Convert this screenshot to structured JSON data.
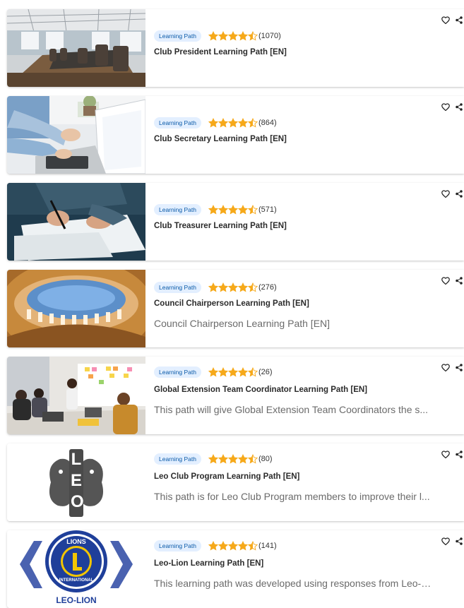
{
  "colors": {
    "star": "#f6a91a",
    "badge_bg": "#e3efff",
    "badge_text": "#0a5aa8"
  },
  "cards": [
    {
      "image": "conference-room-image",
      "badge": "Learning Path",
      "rating": 4.5,
      "count": "(1070)",
      "title": "Club President Learning Path [EN]",
      "description": ""
    },
    {
      "image": "laptop-desk-image",
      "badge": "Learning Path",
      "rating": 4.5,
      "count": "(864)",
      "title": "Club Secretary Learning Path [EN]",
      "description": ""
    },
    {
      "image": "signing-document-image",
      "badge": "Learning Path",
      "rating": 4.5,
      "count": "(571)",
      "title": "Club Treasurer Learning Path [EN]",
      "description": ""
    },
    {
      "image": "dome-ceiling-image",
      "badge": "Learning Path",
      "rating": 4.5,
      "count": "(276)",
      "title": "Council Chairperson Learning Path [EN]",
      "description": "Council Chairperson Learning Path [EN]"
    },
    {
      "image": "team-meeting-image",
      "badge": "Learning Path",
      "rating": 4.5,
      "count": "(26)",
      "title": "Global Extension Team Coordinator Learning Path [EN]",
      "description": "This path will give Global Extension Team Coordinators the s..."
    },
    {
      "image": "leo-logo",
      "badge": "Learning Path",
      "rating": 4.5,
      "count": "(80)",
      "title": "Leo Club Program Learning Path [EN]",
      "description": "This path is for Leo Club Program members to improve their l..."
    },
    {
      "image": "leo-lion-logo",
      "badge": "Learning Path",
      "rating": 4.5,
      "count": "(141)",
      "title": "Leo-Lion Learning Path [EN]",
      "description": "This learning path was developed using responses from Leo-Li...",
      "logo_text": {
        "lions": "LIONS",
        "international": "INTERNATIONAL",
        "caption": "LEO-LION"
      }
    },
    {
      "image": "leo-logo-small",
      "badge": "",
      "rating": 0,
      "count": "",
      "title": "",
      "description": ""
    }
  ],
  "leo_logo_text": "LEO"
}
